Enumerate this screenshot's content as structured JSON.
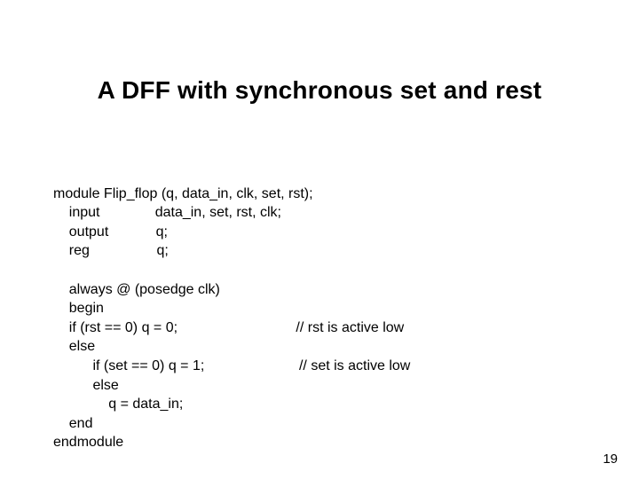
{
  "title": "A DFF with synchronous set and rest",
  "code": {
    "l1": "module Flip_flop (q, data_in, clk, set, rst);",
    "l2": "    input              data_in, set, rst, clk;",
    "l3": "    output            q;",
    "l4": "    reg                 q;",
    "l5": "",
    "l6": "    always @ (posedge clk)",
    "l7": "    begin",
    "l8": "    if (rst == 0) q = 0;                              // rst is active low",
    "l9": "    else",
    "l10": "          if (set == 0) q = 1;                        // set is active low",
    "l11": "          else",
    "l12": "              q = data_in;",
    "l13": "    end",
    "l14": "endmodule"
  },
  "page_number": "19"
}
